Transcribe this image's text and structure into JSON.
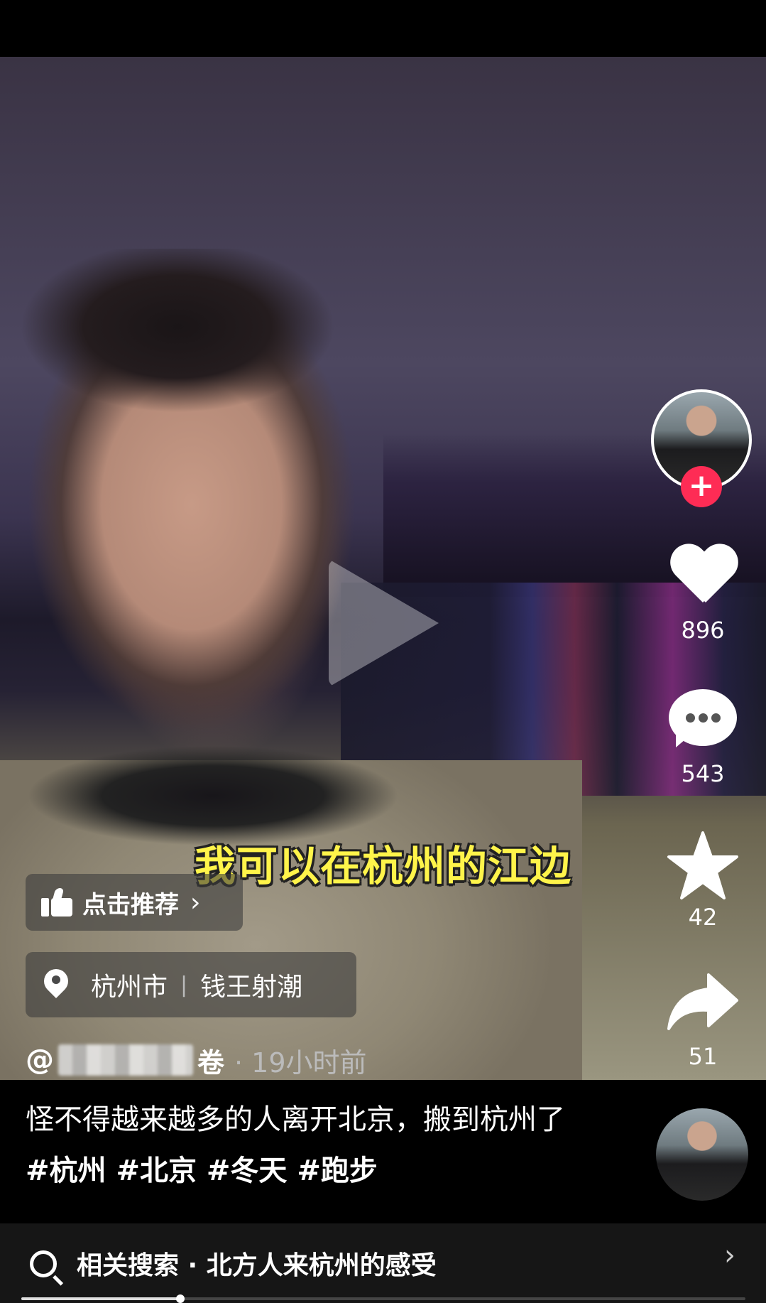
{
  "video": {
    "caption": "我可以在杭州的江边",
    "progress": 0.22
  },
  "recommend": {
    "label": "点击推荐",
    "chevron": "›"
  },
  "location": {
    "city": "杭州市",
    "separator": "|",
    "poi": "钱王射潮"
  },
  "author": {
    "prefix": "@",
    "name_suffix": "卷",
    "time": "· 19小时前"
  },
  "description": {
    "text": "怪不得越来越多的人离开北京，搬到杭州了",
    "tags": "#杭州 #北京 #冬天 #跑步"
  },
  "actions": {
    "likes": "896",
    "comments": "543",
    "favorites": "42",
    "shares": "51",
    "follow_symbol": "+"
  },
  "search": {
    "text": "相关搜索 · 北方人来杭州的感受",
    "chevron": "›"
  },
  "icons": [
    "thumbs-up-icon",
    "location-pin-icon",
    "heart-icon",
    "comment-icon",
    "star-icon",
    "share-icon",
    "search-icon"
  ],
  "colors": {
    "caption_yellow": "#fff44a",
    "follow_red": "#fe2c55"
  }
}
